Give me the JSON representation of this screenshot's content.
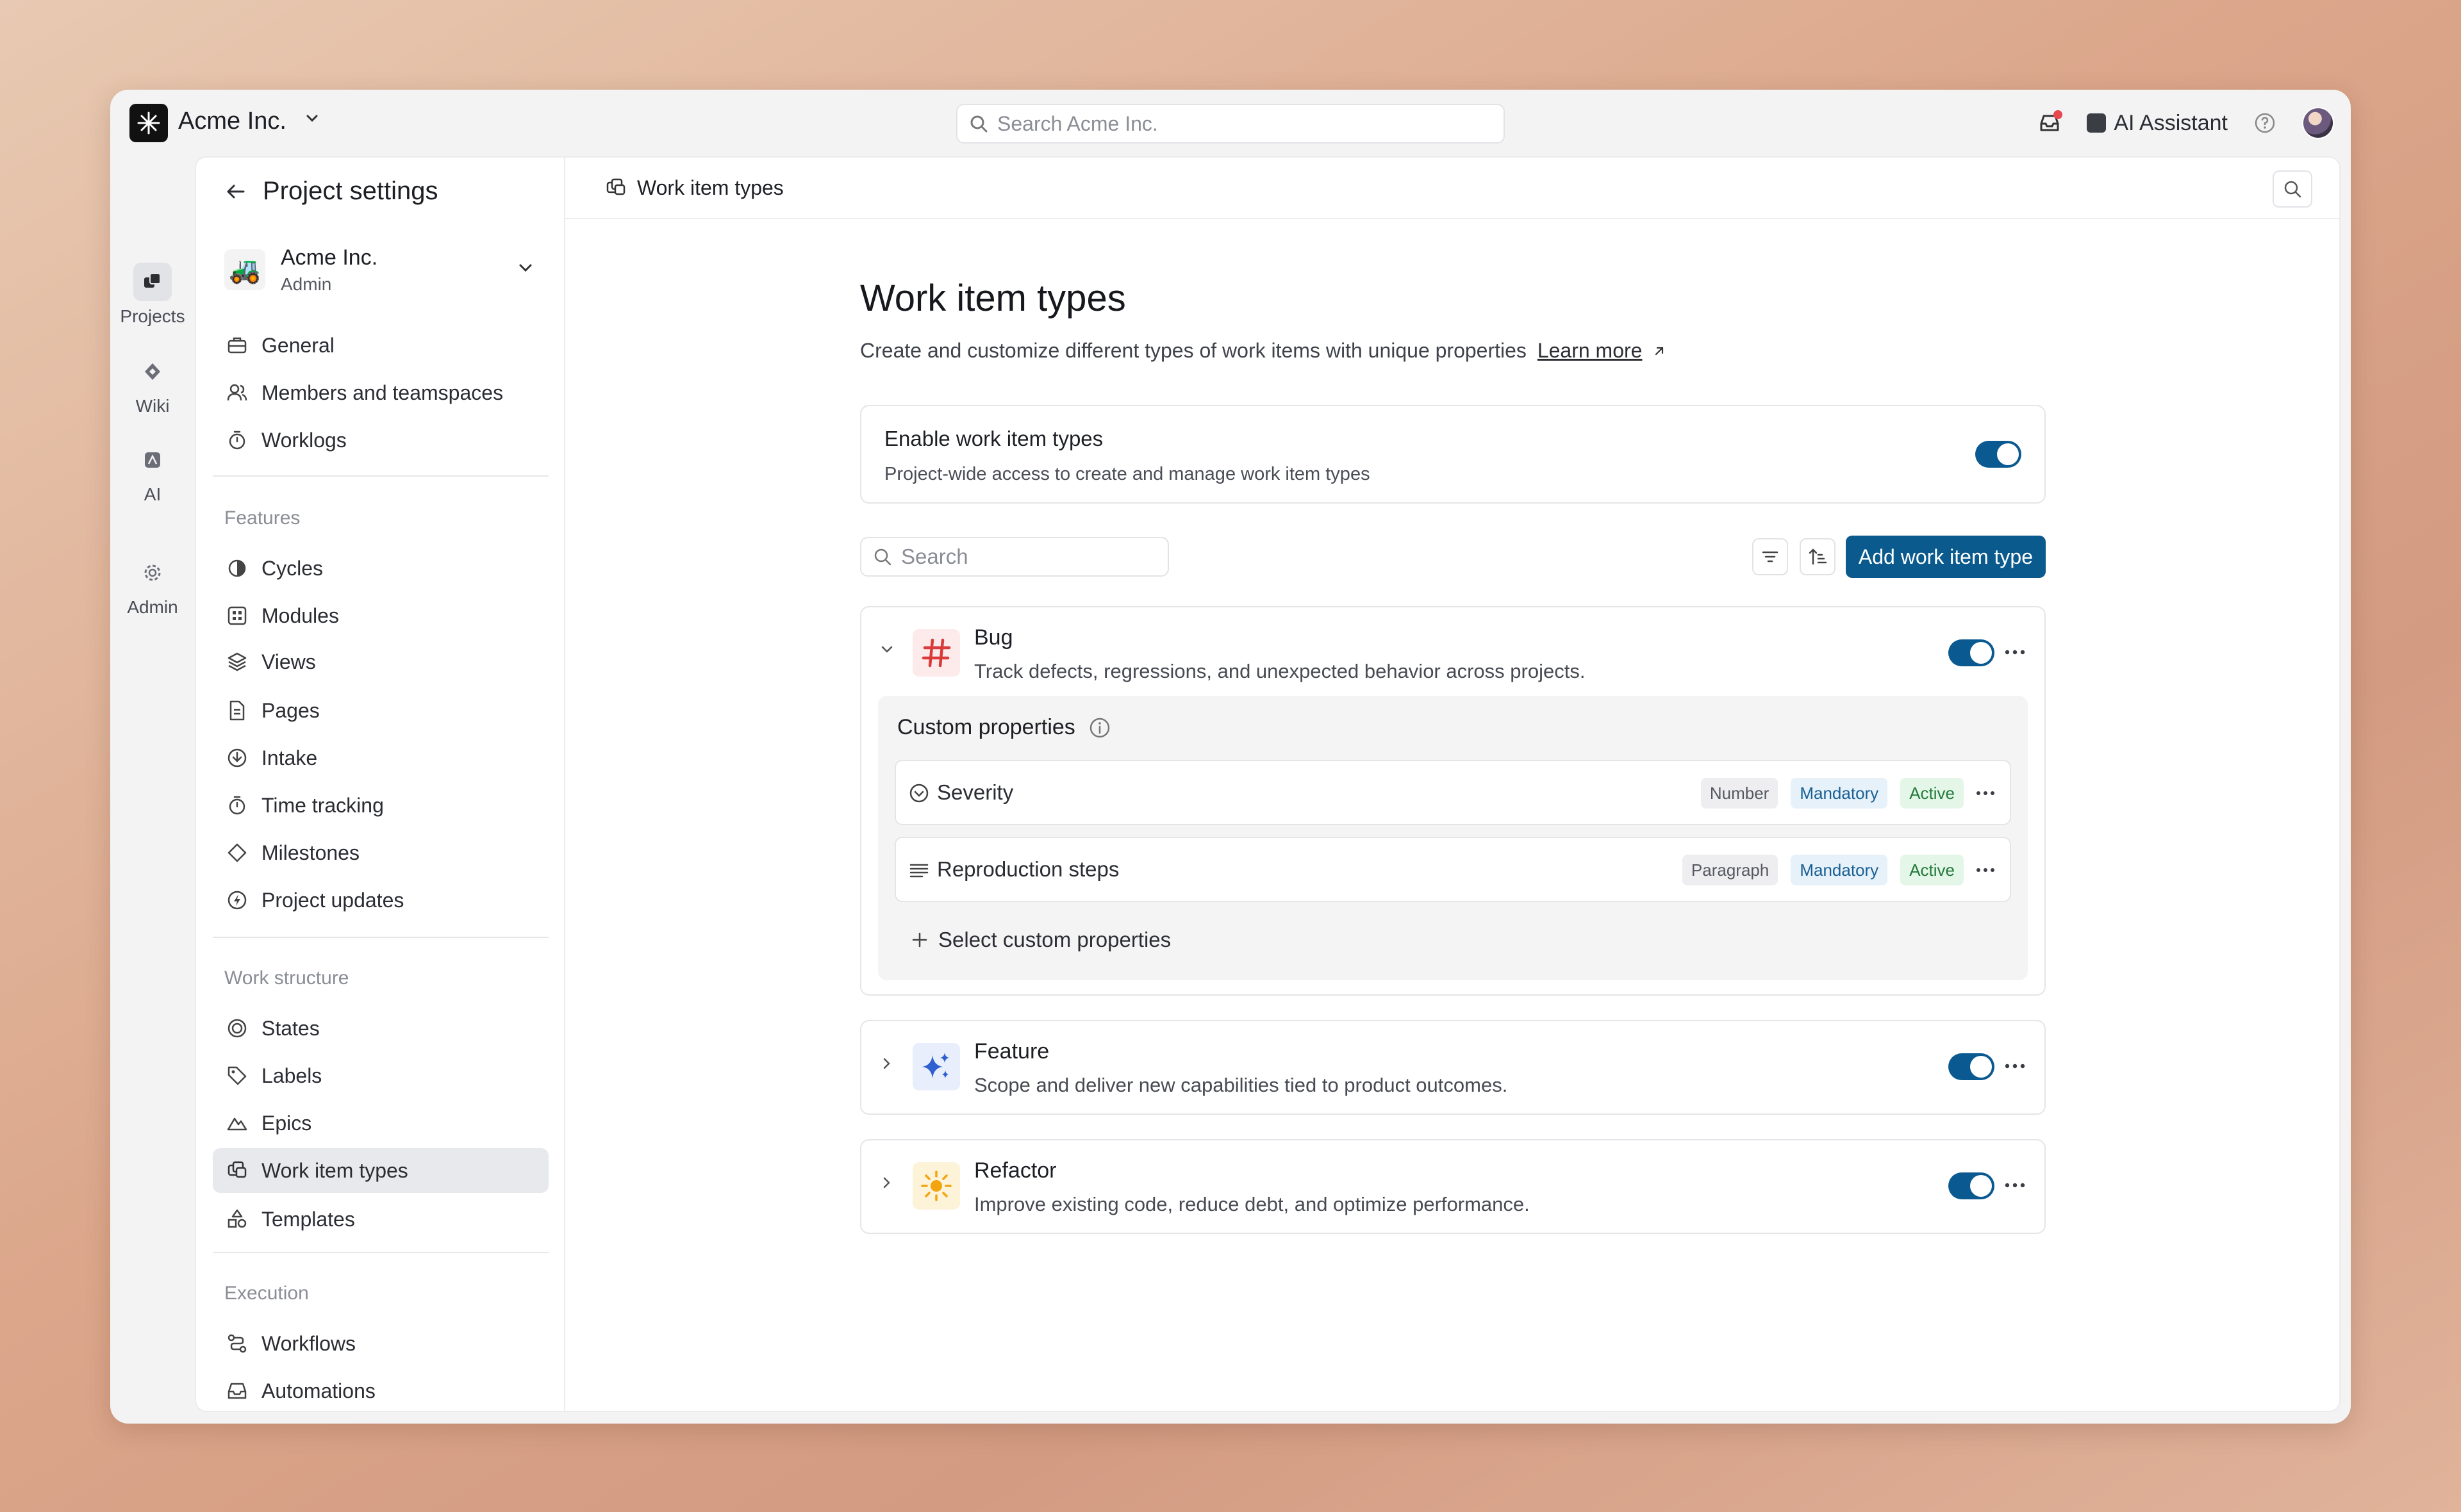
{
  "workspace": {
    "name": "Acme Inc."
  },
  "topbar": {
    "search_placeholder": "Search Acme Inc.",
    "ai_assistant_label": "AI Assistant"
  },
  "rail": [
    {
      "label": "Projects",
      "icon": "projects-icon"
    },
    {
      "label": "Wiki",
      "icon": "wiki-icon"
    },
    {
      "label": "AI",
      "icon": "ai-icon"
    },
    {
      "label": "Admin",
      "icon": "gear-icon"
    }
  ],
  "sidebar": {
    "title": "Project settings",
    "workspace_name": "Acme Inc.",
    "workspace_role": "Admin",
    "workspace_emoji": "🚜",
    "top_items": [
      "General",
      "Members and teamspaces",
      "Worklogs"
    ],
    "features_label": "Features",
    "features_items": [
      "Cycles",
      "Modules",
      "Views",
      "Pages",
      "Intake",
      "Time tracking",
      "Milestones",
      "Project updates"
    ],
    "work_structure_label": "Work structure",
    "work_structure_items": [
      "States",
      "Labels",
      "Epics",
      "Work item types",
      "Templates"
    ],
    "execution_label": "Execution",
    "execution_items": [
      "Workflows",
      "Automations"
    ]
  },
  "content": {
    "breadcrumb": "Work item types",
    "heading": "Work item types",
    "subtitle": "Create and customize different types of work items with unique properties",
    "learn_more": "Learn more",
    "enable": {
      "title": "Enable work item types",
      "description": "Project-wide access to create and manage work item types",
      "enabled": true
    },
    "search_placeholder": "Search",
    "add_button": "Add work item type",
    "types": [
      {
        "name": "Bug",
        "description": "Track defects, regressions, and unexpected behavior across projects.",
        "icon": "hash-icon",
        "icon_color": "#d93b3b",
        "icon_bg": "#fdeaea",
        "expanded": true,
        "enabled": true
      },
      {
        "name": "Feature",
        "description": "Scope and deliver new capabilities tied to product outcomes.",
        "icon": "sparkles-icon",
        "icon_color": "#2f5fd0",
        "icon_bg": "#e8eefb",
        "expanded": false,
        "enabled": true
      },
      {
        "name": "Refactor",
        "description": "Improve existing code, reduce debt, and optimize performance.",
        "icon": "sun-icon",
        "icon_color": "#f2a50f",
        "icon_bg": "#fdf3d8",
        "expanded": false,
        "enabled": true
      }
    ],
    "custom_properties": {
      "title": "Custom properties",
      "items": [
        {
          "name": "Severity",
          "type": "Number",
          "mandatory": "Mandatory",
          "status": "Active",
          "icon": "check-circle-icon"
        },
        {
          "name": "Reproduction steps",
          "type": "Paragraph",
          "mandatory": "Mandatory",
          "status": "Active",
          "icon": "paragraph-icon"
        }
      ],
      "add_label": "Select custom properties"
    }
  },
  "colors": {
    "accent": "#0b5a8e",
    "toggle_on": "#0a5a91"
  }
}
